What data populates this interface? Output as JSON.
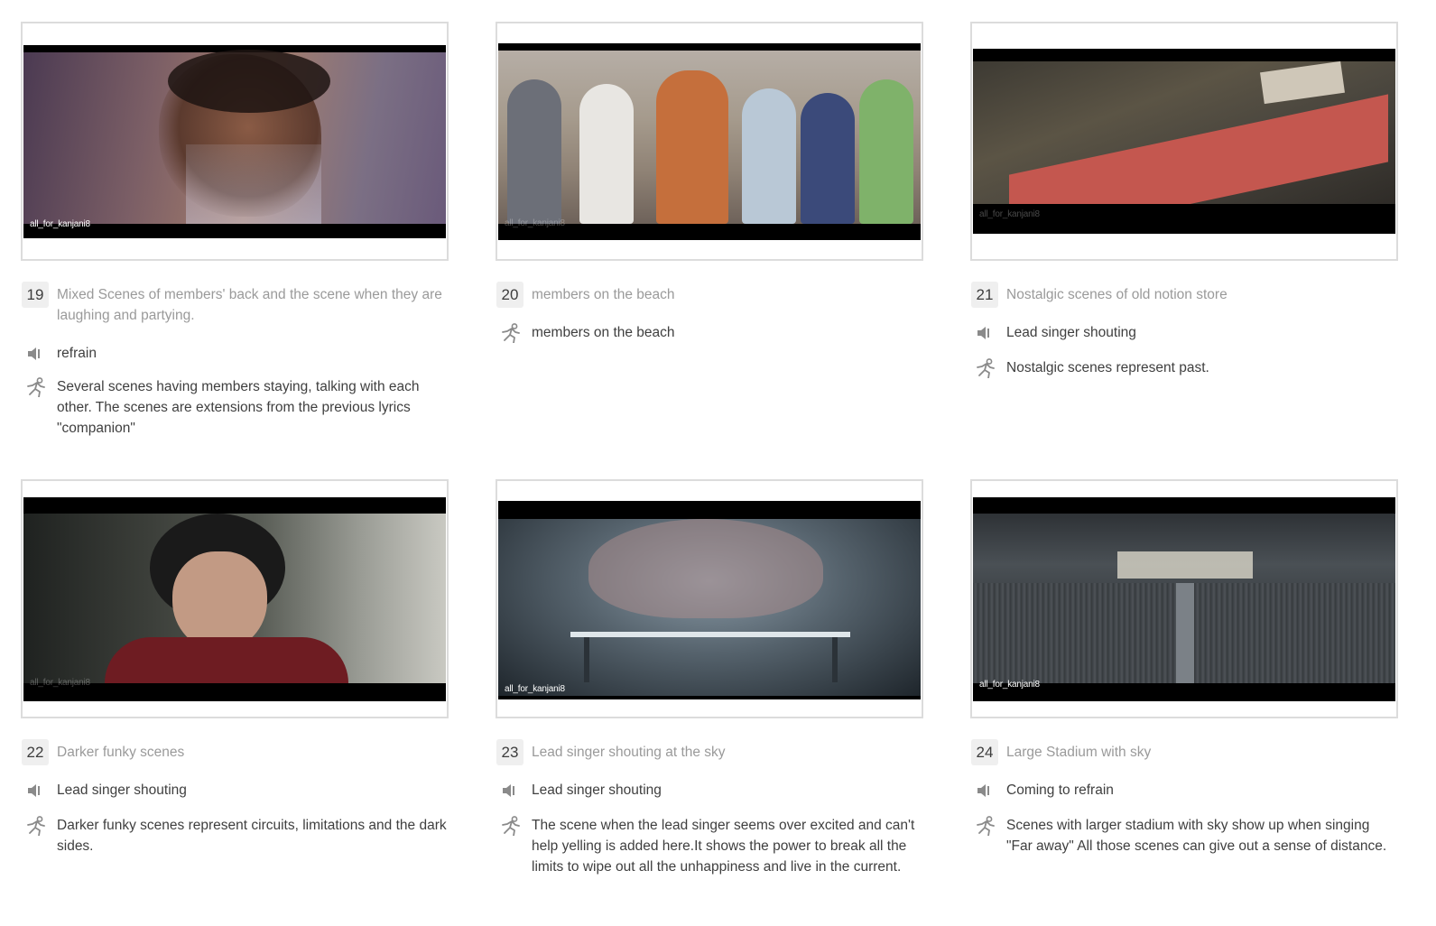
{
  "panels": [
    {
      "number": "19",
      "title": "Mixed Scenes of members' back and the scene when they are laughing and partying.",
      "watermark": "all_for_kanjani8",
      "audio": "refrain",
      "action": "Several scenes having members staying, talking with each other. The scenes are extensions from the previous lyrics \"companion\""
    },
    {
      "number": "20",
      "title": "members on the beach",
      "watermark": "all_for_kanjani8",
      "audio": "",
      "action": "members on the beach"
    },
    {
      "number": "21",
      "title": "Nostalgic scenes of old notion store",
      "watermark": "all_for_kanjani8",
      "audio": "Lead singer shouting",
      "action": "Nostalgic scenes represent past."
    },
    {
      "number": "22",
      "title": "Darker funky scenes",
      "watermark": "all_for_kanjani8",
      "audio": "Lead singer shouting",
      "action": "Darker funky scenes represent circuits, limitations and the dark sides."
    },
    {
      "number": "23",
      "title": "Lead singer shouting at the sky",
      "watermark": "all_for_kanjani8",
      "audio": "Lead singer shouting",
      "action": "The scene when the lead singer seems over excited and can't help yelling is added here.It shows the power to break all the limits to wipe out all the unhappiness and live in the current."
    },
    {
      "number": "24",
      "title": "Large Stadium with sky",
      "watermark": "all_for_kanjani8",
      "audio": "Coming to refrain",
      "action": "Scenes with larger stadium with sky show up when singing \"Far away\" All those scenes can give out a sense of distance."
    }
  ],
  "icons": {
    "audio": "speaker-icon",
    "action": "running-person-icon"
  },
  "colors": {
    "border": "#dcdcdc",
    "number_bg": "#efefef",
    "title": "#9a9a9a",
    "text": "#3f3f3f",
    "icon": "#8a8a8a"
  }
}
